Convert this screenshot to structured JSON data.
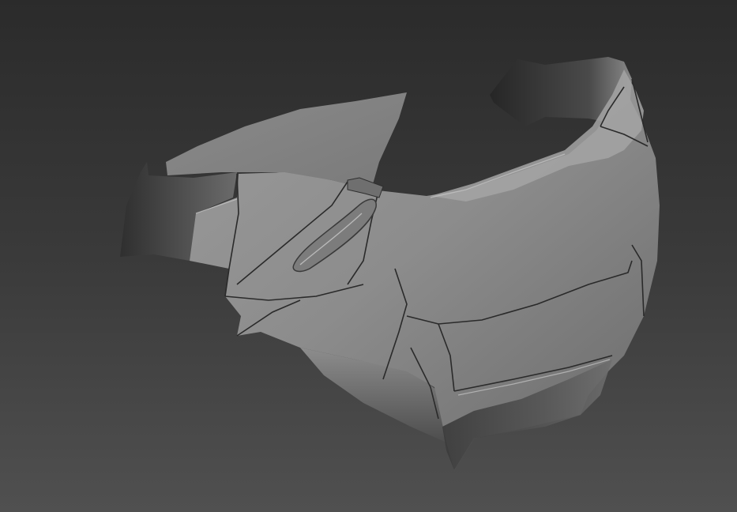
{
  "scene": {
    "background_top": "#2b2b2b",
    "background_bottom": "#505050",
    "object": "armor-chest-plate-model",
    "shading": "grey-clay"
  }
}
